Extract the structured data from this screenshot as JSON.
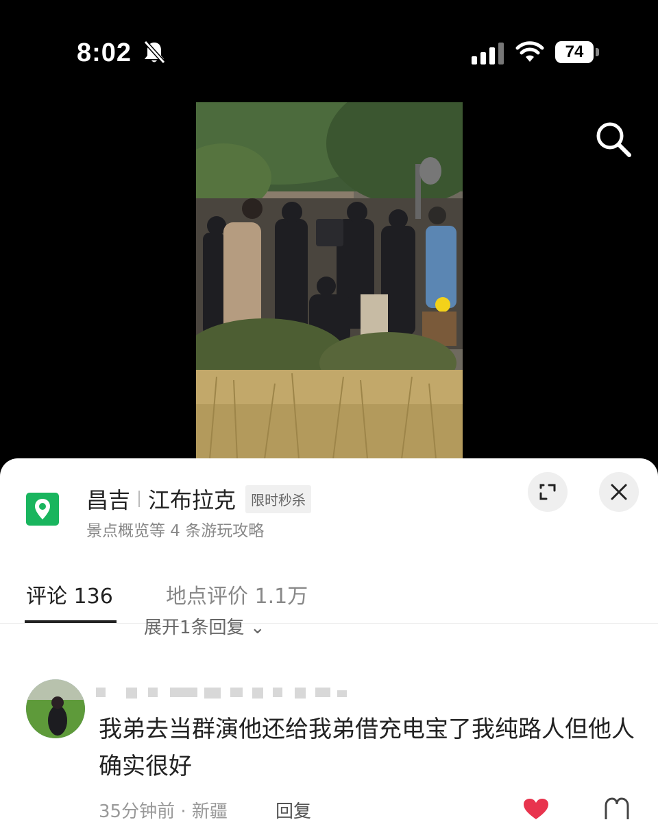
{
  "status_bar": {
    "time": "8:02",
    "battery": "74"
  },
  "location_card": {
    "title_city": "昌吉",
    "title_place": "江布拉克",
    "tag": "限时秒杀",
    "subtitle": "景点概览等 4 条游玩攻略"
  },
  "tabs": [
    {
      "label": "评论 136"
    },
    {
      "label": "地点评价 1.1万"
    }
  ],
  "expand_replies": "展开1条回复",
  "comment": {
    "text": "我弟去当群演他还给我弟借充电宝了我纯路人但他人确实很好",
    "meta": "35分钟前 · 新疆",
    "reply_label": "回复"
  },
  "colors": {
    "pin_green": "#19b55e",
    "like_red": "#e8344e"
  }
}
